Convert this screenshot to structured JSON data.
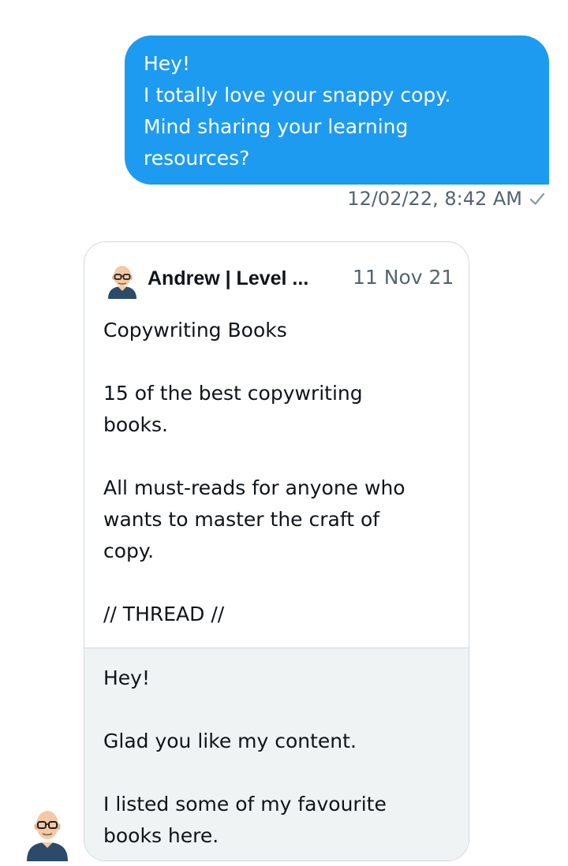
{
  "sent_message": {
    "lines": [
      "Hey!",
      "I totally love your snappy copy.",
      "Mind sharing your learning",
      "resources?"
    ],
    "timestamp": "12/02/22, 8:42 AM",
    "status_icon": "check-icon"
  },
  "quoted_tweet": {
    "author_name": "Andrew | Level ...",
    "date": "11 Nov 21",
    "avatar_icon": "bald-man-glasses-avatar",
    "lines": [
      "Copywriting Books",
      "",
      "15 of the best copywriting",
      "books.",
      "",
      "All must-reads for anyone who",
      "wants to master the craft of",
      "copy.",
      "",
      "// THREAD //"
    ]
  },
  "reply_message": {
    "lines": [
      "Hey!",
      "",
      "Glad you like my content.",
      "",
      "I listed some of my favourite",
      "books here."
    ],
    "avatar_icon": "bald-man-glasses-avatar"
  },
  "colors": {
    "sent_bubble": "#1d9bf0",
    "received_bubble": "#eff3f4",
    "muted_text": "#536471",
    "border": "#cfd9de"
  }
}
